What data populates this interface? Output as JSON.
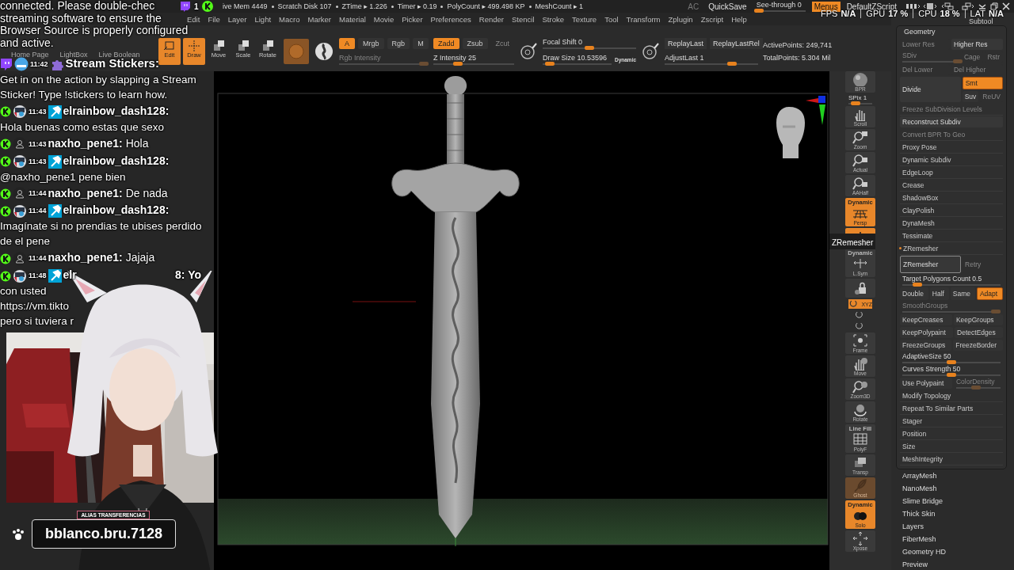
{
  "overlay": {
    "viewer_count": "1",
    "notice": [
      "connected. Please double-chec",
      "streaming software to ensure the",
      "Browser Source is properly configured",
      "and active."
    ],
    "messages": [
      {
        "kind": "bot",
        "time": "11:42",
        "user": "Stream Stickers:",
        "text": "Get in on the action by slapping a Stream Sticker! Type !stickers to learn how."
      },
      {
        "kind": "mod",
        "time": "11:43",
        "user": "elrainbow_dash128:",
        "text": "Hola buenas como estas que sexo"
      },
      {
        "kind": "user",
        "time": "11:43",
        "user": "naxho_pene1:",
        "text": "Hola"
      },
      {
        "kind": "mod",
        "time": "11:43",
        "user": "elrainbow_dash128:",
        "text": "@naxho_pene1 pene bien"
      },
      {
        "kind": "user",
        "time": "11:44",
        "user": "naxho_pene1:",
        "text": "De nada"
      },
      {
        "kind": "mod",
        "time": "11:44",
        "user": "elrainbow_dash128:",
        "text": "Imagínate si no prendias te ubises perdido de el pene"
      },
      {
        "kind": "user",
        "time": "11:44",
        "user": "naxho_pene1:",
        "text": "Jajaja"
      },
      {
        "kind": "mod",
        "time": "11:48",
        "user": "elr",
        "tail": "8: Yo",
        "text": "con usted\nhttps://vm.tikto\npero si tuviera r"
      }
    ],
    "alias": "ALIAS TRANSFERENCIAS",
    "handle": "bblanco.bru.7128"
  },
  "status_bar": {
    "items": [
      "ive Mem 4449",
      "Scratch Disk 107",
      "ZTime ▸ 1.226",
      "Timer ▸ 0.19",
      "PolyCount ▸ 499.498 KP",
      "MeshCount ▸ 1"
    ],
    "ac": "AC",
    "quicksave": "QuickSave",
    "see_through": {
      "label": "See-through 0",
      "level": 0.05
    },
    "menus": {
      "label": "Menus",
      "on": true
    },
    "script": "DefaultZScript"
  },
  "perf": [
    {
      "label": "FPS",
      "value": "N/A"
    },
    {
      "label": "GPU",
      "value": "17 %"
    },
    {
      "label": "CPU",
      "value": "18 %"
    },
    {
      "label": "LAT",
      "value": "N/A"
    }
  ],
  "menu": [
    "Edit",
    "File",
    "Layer",
    "Light",
    "Macro",
    "Marker",
    "Material",
    "Movie",
    "Picker",
    "Preferences",
    "Render",
    "Stencil",
    "Stroke",
    "Texture",
    "Tool",
    "Transform",
    "Zplugin",
    "Zscript",
    "Help"
  ],
  "toolbar": {
    "tabs": [
      "Home Page",
      "LightBox",
      "Live Boolean"
    ],
    "modes": [
      {
        "label": "Edit",
        "on": true
      },
      {
        "label": "Draw",
        "on": true
      },
      {
        "label": "Move",
        "on": false
      },
      {
        "label": "Scale",
        "on": false
      },
      {
        "label": "Rotate",
        "on": false
      }
    ],
    "channels": [
      {
        "label": "A",
        "on": true
      },
      {
        "label": "Mrgb",
        "on": false
      },
      {
        "label": "Rgb",
        "on": false
      },
      {
        "label": "M",
        "on": false
      }
    ],
    "rgb_intensity": {
      "label": "Rgb Intensity",
      "disabled": true,
      "level": 0.95
    },
    "z_modes": [
      {
        "label": "Zadd",
        "on": true,
        "disabled": false
      },
      {
        "label": "Zsub",
        "on": false,
        "disabled": false
      },
      {
        "label": "Zcut",
        "on": false,
        "disabled": true
      }
    ],
    "z_intensity": {
      "label": "Z Intensity 25",
      "level": 0.3
    },
    "focal_shift": {
      "label": "Focal Shift 0",
      "level": 0.5
    },
    "draw_size": {
      "label": "Draw Size 10.53596",
      "level": 0.1
    },
    "dynamic": "Dynamic",
    "replay": [
      "ReplayLast",
      "ReplayLastRel"
    ],
    "adjust_last": {
      "label": "AdjustLast 1",
      "level": 0.72
    },
    "active_points": "ActivePoints: 249,741",
    "total_points": "TotalPoints: 5.304 Mil"
  },
  "right_tools": [
    {
      "kind": "button",
      "label": "BPR",
      "on": false,
      "disabled": false
    },
    {
      "kind": "slider",
      "label": "SPix 1",
      "level": 0.3
    },
    {
      "kind": "button",
      "label": "Scroll",
      "on": false,
      "disabled": false
    },
    {
      "kind": "button",
      "label": "Zoom",
      "on": false,
      "disabled": false
    },
    {
      "kind": "button",
      "label": "Actual",
      "on": false,
      "disabled": false
    },
    {
      "kind": "button",
      "label": "AAHalf",
      "on": false,
      "disabled": false
    },
    {
      "kind": "button",
      "caption": "Dynamic",
      "label": "Persp",
      "on": true,
      "disabled": false
    },
    {
      "kind": "button",
      "on": true,
      "disabled": false
    },
    {
      "kind": "button",
      "caption": "Dynamic",
      "label": "L.Sym",
      "on": false,
      "disabled": false
    },
    {
      "kind": "button",
      "on": false,
      "disabled": false
    },
    {
      "kind": "small",
      "label": "XYZ",
      "on": true
    },
    {
      "kind": "small",
      "on": false
    },
    {
      "kind": "small",
      "on": false
    },
    {
      "kind": "button",
      "label": "Frame",
      "on": false,
      "disabled": false
    },
    {
      "kind": "button",
      "label": "Move",
      "on": false,
      "disabled": false
    },
    {
      "kind": "button",
      "label": "Zoom3D",
      "on": false,
      "disabled": false
    },
    {
      "kind": "button",
      "label": "Rotate",
      "on": false,
      "disabled": false
    },
    {
      "kind": "button",
      "caption": "Line Fill",
      "label": "PolyF",
      "on": false,
      "disabled": false
    },
    {
      "kind": "button",
      "label": "Transp",
      "on": false,
      "disabled": false
    },
    {
      "kind": "button",
      "label": "Ghost",
      "on": true,
      "disabled": true
    },
    {
      "kind": "button",
      "caption": "Dynamic",
      "label": "Solo",
      "on": true,
      "disabled": false
    },
    {
      "kind": "button",
      "label": "Xpose",
      "on": false,
      "disabled": false
    }
  ],
  "tooltip": "ZRemesher",
  "right_panel": {
    "subtool": "Subtool",
    "title": "Geometry",
    "rows": [
      {
        "cells": [
          {
            "kind": "button",
            "label": "Lower Res",
            "disabled": true
          },
          {
            "kind": "button",
            "label": "Higher Res",
            "disabled": false
          }
        ]
      },
      {
        "cells": [
          {
            "kind": "slider",
            "label": "SDiv",
            "disabled": true,
            "level": 1
          },
          {
            "kind": "group",
            "rows": [
              {
                "cells": [
                  {
                    "kind": "button",
                    "label": "Cage",
                    "disabled": true
                  },
                  {
                    "kind": "button",
                    "label": "Rstr",
                    "disabled": true
                  }
                ]
              }
            ]
          }
        ]
      },
      {
        "cells": [
          {
            "kind": "button",
            "label": "Del Lower",
            "disabled": true
          },
          {
            "kind": "button",
            "label": "Del Higher",
            "disabled": true
          }
        ]
      },
      {
        "cells": [
          {
            "kind": "button",
            "label": "Divide",
            "disabled": false
          },
          {
            "kind": "group",
            "rows": [
              {
                "cells": [
                  {
                    "kind": "toggle",
                    "label": "Smt",
                    "on": true
                  }
                ]
              },
              {
                "cells": [
                  {
                    "kind": "toggle",
                    "label": "Suv",
                    "on": false
                  },
                  {
                    "kind": "button",
                    "label": "ReUV",
                    "disabled": true
                  }
                ]
              }
            ]
          }
        ]
      },
      {
        "cells": [
          {
            "kind": "item",
            "label": "Freeze SubDivision Levels",
            "disabled": true,
            "expanded": false
          }
        ]
      },
      {
        "cells": [
          {
            "kind": "button",
            "label": "Reconstruct Subdiv",
            "disabled": false
          }
        ]
      },
      {
        "cells": [
          {
            "kind": "item",
            "label": "Convert BPR To Geo",
            "disabled": true,
            "expanded": false
          }
        ]
      },
      {
        "cells": [
          {
            "kind": "item",
            "label": "Proxy Pose",
            "disabled": false,
            "expanded": false
          }
        ]
      },
      {
        "cells": [
          {
            "kind": "item",
            "label": "Dynamic Subdiv",
            "disabled": false,
            "expanded": false
          }
        ]
      },
      {
        "cells": [
          {
            "kind": "item",
            "label": "EdgeLoop",
            "disabled": false,
            "expanded": false
          }
        ]
      },
      {
        "cells": [
          {
            "kind": "item",
            "label": "Crease",
            "disabled": false,
            "expanded": false
          }
        ]
      },
      {
        "cells": [
          {
            "kind": "item",
            "label": "ShadowBox",
            "disabled": false,
            "expanded": false
          }
        ]
      },
      {
        "cells": [
          {
            "kind": "item",
            "label": "ClayPolish",
            "disabled": false,
            "expanded": false
          }
        ]
      },
      {
        "cells": [
          {
            "kind": "item",
            "label": "DynaMesh",
            "disabled": false,
            "expanded": false
          }
        ]
      },
      {
        "cells": [
          {
            "kind": "item",
            "label": "Tessimate",
            "disabled": false,
            "expanded": false
          }
        ]
      },
      {
        "cells": [
          {
            "kind": "item",
            "label": "ZRemesher",
            "disabled": false,
            "expanded": true
          }
        ]
      },
      {
        "cells": [
          {
            "kind": "button",
            "label": "ZRemesher",
            "disabled": false,
            "highlighted": true
          },
          {
            "kind": "button",
            "label": "Retry",
            "disabled": true,
            "highlighted": false
          }
        ]
      },
      {
        "cells": [
          {
            "kind": "slider",
            "label": "Target Polygons Count 0.5",
            "disabled": false,
            "level": 0.15
          }
        ]
      },
      {
        "cells": [
          {
            "kind": "toggle",
            "label": "Double",
            "on": false
          },
          {
            "kind": "toggle",
            "label": "Half",
            "on": false
          },
          {
            "kind": "toggle",
            "label": "Same",
            "on": false
          },
          {
            "kind": "toggle",
            "label": "Adapt",
            "on": true
          }
        ]
      },
      {
        "cells": [
          {
            "kind": "slider",
            "label": "SmoothGroups",
            "disabled": true,
            "level": 0.95
          }
        ]
      },
      {
        "cells": [
          {
            "kind": "toggle",
            "label": "KeepCreases",
            "on": false
          },
          {
            "kind": "toggle",
            "label": "KeepGroups",
            "on": false
          }
        ]
      },
      {
        "cells": [
          {
            "kind": "toggle",
            "label": "KeepPolypaint",
            "on": false
          },
          {
            "kind": "toggle",
            "label": "DetectEdges",
            "on": false
          }
        ]
      },
      {
        "cells": [
          {
            "kind": "toggle",
            "label": "FreezeGroups",
            "on": false
          },
          {
            "kind": "toggle",
            "label": "FreezeBorder",
            "on": false
          }
        ]
      },
      {
        "cells": [
          {
            "kind": "slider",
            "label": "AdaptiveSize 50",
            "disabled": false,
            "level": 0.5
          }
        ]
      },
      {
        "cells": [
          {
            "kind": "slider",
            "label": "Curves Strength 50",
            "disabled": false,
            "level": 0.5
          }
        ]
      },
      {
        "cells": [
          {
            "kind": "toggle",
            "label": "Use Polypaint",
            "on": false
          },
          {
            "kind": "slider",
            "label": "ColorDensity",
            "disabled": true,
            "level": 0.45
          }
        ]
      },
      {
        "cells": [
          {
            "kind": "item",
            "label": "Modify Topology",
            "disabled": false,
            "expanded": false
          }
        ]
      },
      {
        "cells": [
          {
            "kind": "item",
            "label": "Repeat To Similar Parts",
            "disabled": false,
            "expanded": false
          }
        ]
      },
      {
        "cells": [
          {
            "kind": "item",
            "label": "Stager",
            "disabled": false,
            "expanded": false
          }
        ]
      },
      {
        "cells": [
          {
            "kind": "item",
            "label": "Position",
            "disabled": false,
            "expanded": false
          }
        ]
      },
      {
        "cells": [
          {
            "kind": "item",
            "label": "Size",
            "disabled": false,
            "expanded": false
          }
        ]
      },
      {
        "cells": [
          {
            "kind": "item",
            "label": "MeshIntegrity",
            "disabled": false,
            "expanded": false
          }
        ]
      }
    ],
    "subpalettes": [
      "ArrayMesh",
      "NanoMesh",
      "Slime Bridge",
      "Thick Skin",
      "Layers",
      "FiberMesh",
      "Geometry HD",
      "Preview"
    ]
  }
}
